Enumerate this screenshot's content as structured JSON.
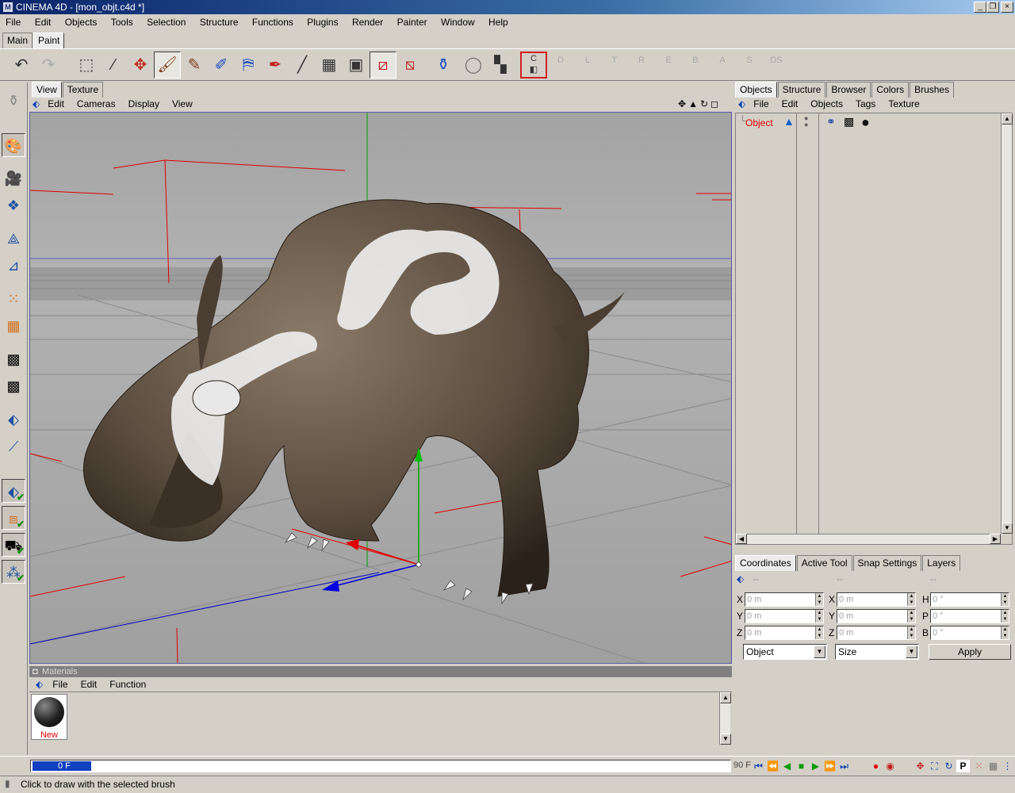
{
  "app": {
    "title": "CINEMA 4D - [mon_objt.c4d *]",
    "icon": "cinema4d-app-icon"
  },
  "window_controls": {
    "minimize": "_",
    "restore": "❐",
    "close": "×"
  },
  "menu": [
    "File",
    "Edit",
    "Objects",
    "Tools",
    "Selection",
    "Structure",
    "Functions",
    "Plugins",
    "Render",
    "Painter",
    "Window",
    "Help"
  ],
  "layout_tabs": [
    "Main",
    "Paint"
  ],
  "layout_tab_active": "Paint",
  "toolbar": {
    "icons": [
      "undo-icon",
      "redo-icon",
      "rectangle-select-icon",
      "magic-wand-icon",
      "move-icon",
      "paint-brush-icon",
      "smudge-brush-icon",
      "clone-brush-icon",
      "fill-icon",
      "eyedropper-icon",
      "line-icon",
      "checker-texture-icon",
      "texture-view-icon",
      "projection-icon",
      "bake-icon",
      "material-paint-icon",
      "circle-mask-icon",
      "channel-toggle-icon",
      "color-channel-icon"
    ],
    "channels": [
      "D",
      "L",
      "T",
      "R",
      "E",
      "B",
      "A",
      "S",
      "DS"
    ],
    "color_channel_label": "C"
  },
  "view_tabs": [
    "View",
    "Texture"
  ],
  "view_menu": [
    "Edit",
    "Cameras",
    "Display",
    "View"
  ],
  "right_tabs": [
    "Objects",
    "Structure",
    "Browser",
    "Colors",
    "Brushes"
  ],
  "object_menu": [
    "File",
    "Edit",
    "Objects",
    "Tags",
    "Texture"
  ],
  "objects": [
    {
      "name": "Object",
      "tags": [
        "phong-tag-icon",
        "texture-tag-icon",
        "material-tag-icon"
      ]
    }
  ],
  "coord_tabs": [
    "Coordinates",
    "Active Tool",
    "Snap Settings",
    "Layers"
  ],
  "coord_headers": [
    "--",
    "--",
    "--"
  ],
  "coords": {
    "col1": [
      {
        "label": "X",
        "value": "0 m"
      },
      {
        "label": "Y",
        "value": "0 m"
      },
      {
        "label": "Z",
        "value": "0 m"
      }
    ],
    "col2": [
      {
        "label": "X",
        "value": "0 m"
      },
      {
        "label": "Y",
        "value": "0 m"
      },
      {
        "label": "Z",
        "value": "0 m"
      }
    ],
    "col3": [
      {
        "label": "H",
        "value": "0 °"
      },
      {
        "label": "P",
        "value": "0 °"
      },
      {
        "label": "B",
        "value": "0 °"
      }
    ]
  },
  "coord_mode": "Object",
  "coord_size": "Size",
  "apply_label": "Apply",
  "materials": {
    "title": "Materials",
    "menu": [
      "File",
      "Edit",
      "Function"
    ],
    "items": [
      {
        "label": "New"
      }
    ]
  },
  "timeline": {
    "current": "0 F",
    "end": "90 F"
  },
  "status": "Click to draw with the selected brush",
  "colors": {
    "axis_x": "#e00000",
    "axis_y": "#00a000",
    "axis_z": "#0000c0",
    "grid_red": "#e00000",
    "selection": "#e00000"
  }
}
